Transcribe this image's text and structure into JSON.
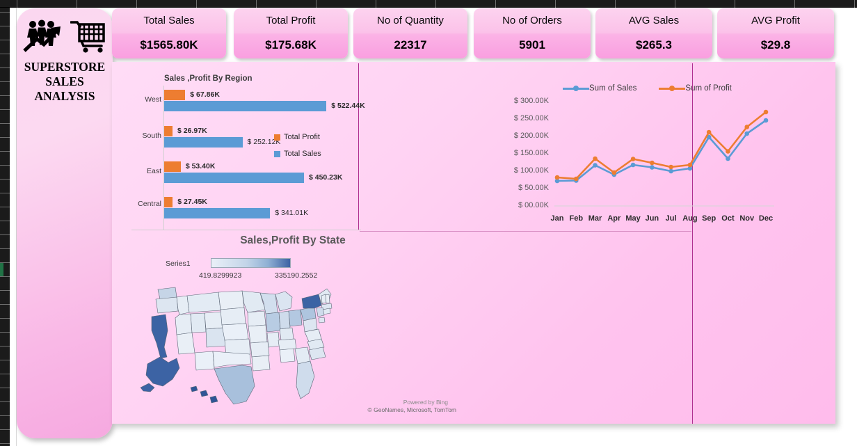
{
  "app": {
    "title_lines": [
      "SUPERSTORE",
      "SALES",
      "ANALYSIS"
    ],
    "icons": [
      "people-growth-icon",
      "shopping-cart-icon"
    ]
  },
  "kpis": [
    {
      "label": "Total Sales",
      "value": "$1565.80K"
    },
    {
      "label": "Total Profit",
      "value": "$175.68K"
    },
    {
      "label": "No of Quantity",
      "value": "22317"
    },
    {
      "label": "No of Orders",
      "value": "5901"
    },
    {
      "label": "AVG Sales",
      "value": "$265.3"
    },
    {
      "label": "AVG Profit",
      "value": "$29.8"
    }
  ],
  "colors": {
    "sales": "#5b9bd5",
    "profit": "#ed7d31",
    "board": "#ffd3f3",
    "card": "#fbc2e9",
    "divider": "#b0308f"
  },
  "map": {
    "title": "Sales,Profit By State",
    "legend_series": "Series1",
    "legend_min": "419.8299923",
    "legend_max": "335190.2552",
    "attribution_1": "Powered by Bing",
    "attribution_2": "© GeoNames, Microsoft, TomTom"
  },
  "chart_data": [
    {
      "type": "bar",
      "title": "Sales ,Profit By Region",
      "orientation": "horizontal",
      "categories": [
        "West",
        "South",
        "East",
        "Central"
      ],
      "legend": [
        "Total Profit",
        "Total Sales"
      ],
      "legend_position": "right-middle",
      "xlabel": "",
      "ylabel": "",
      "xlim": [
        0,
        560
      ],
      "grid": false,
      "series": [
        {
          "name": "Total Profit",
          "color": "#ed7d31",
          "values": [
            67.86,
            26.97,
            53.4,
            27.45
          ],
          "labels": [
            "$ 67.86K",
            "$ 26.97K",
            "$ 53.40K",
            "$ 27.45K"
          ]
        },
        {
          "name": "Total Sales",
          "color": "#5b9bd5",
          "values": [
            522.44,
            252.12,
            450.23,
            341.01
          ],
          "labels": [
            "$ 522.44K",
            "$ 252.12K",
            "$ 450.23K",
            "$ 341.01K"
          ]
        }
      ]
    },
    {
      "type": "line",
      "title": "",
      "categories": [
        "Jan",
        "Feb",
        "Mar",
        "Apr",
        "May",
        "Jun",
        "Jul",
        "Aug",
        "Sep",
        "Oct",
        "Nov",
        "Dec"
      ],
      "legend": [
        "Sum of Sales",
        "Sum of Profit"
      ],
      "legend_position": "top-center",
      "xlabel": "",
      "ylabel": "",
      "ylim": [
        0,
        300
      ],
      "ytick_labels": [
        "$ 00.00K",
        "$ 50.00K",
        "$ 100.00K",
        "$ 150.00K",
        "$ 200.00K",
        "$ 250.00K",
        "$ 300.00K"
      ],
      "ytick_values": [
        0,
        50,
        100,
        150,
        200,
        250,
        300
      ],
      "grid": false,
      "markers": true,
      "series": [
        {
          "name": "Sum of Sales",
          "color": "#5b9bd5",
          "values": [
            72,
            73,
            117,
            90,
            118,
            111,
            100,
            108,
            198,
            136,
            208,
            246
          ]
        },
        {
          "name": "Sum of Profit",
          "color": "#ed7d31",
          "values": [
            82,
            78,
            136,
            96,
            135,
            124,
            112,
            118,
            212,
            157,
            227,
            270
          ]
        }
      ]
    },
    {
      "type": "heatmap",
      "subtype": "choropleth-map",
      "title": "Sales,Profit By State",
      "region": "United States",
      "value_min": 419.8299923,
      "value_max": 335190.2552,
      "colorscale": [
        "#eaf0f8",
        "#3c63a4"
      ],
      "highlighted_states": [
        {
          "state": "California",
          "level": "high"
        },
        {
          "state": "New York",
          "level": "high"
        },
        {
          "state": "Alaska",
          "level": "high"
        },
        {
          "state": "Texas",
          "level": "medium"
        },
        {
          "state": "Pennsylvania",
          "level": "medium"
        },
        {
          "state": "Washington",
          "level": "medium"
        },
        {
          "state": "Illinois",
          "level": "medium"
        },
        {
          "state": "Ohio",
          "level": "medium"
        },
        {
          "state": "Florida",
          "level": "medium-low"
        }
      ]
    }
  ]
}
